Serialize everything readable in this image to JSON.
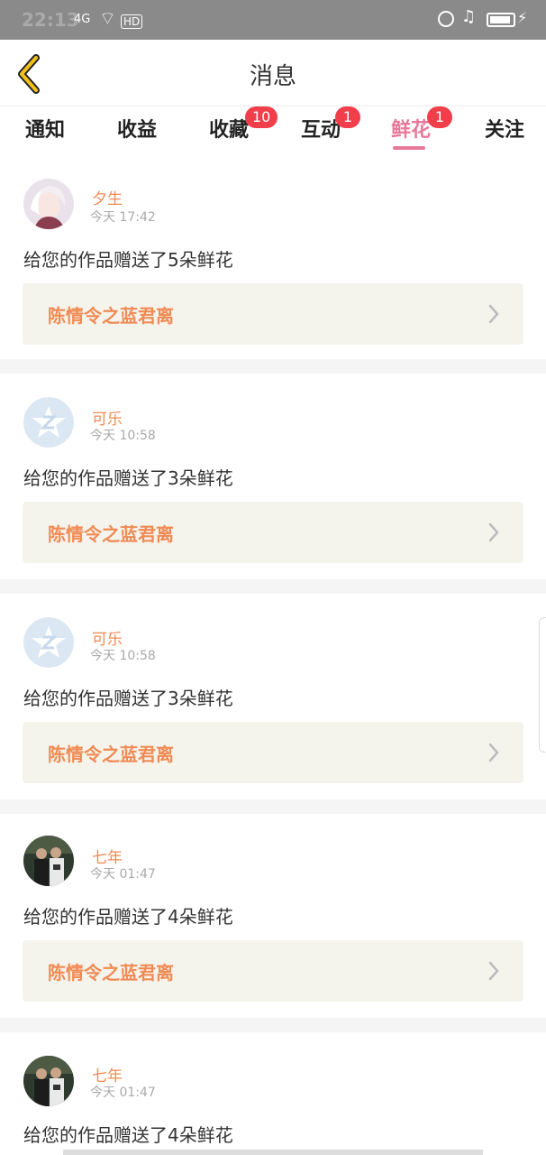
{
  "status_bar": {
    "time": "22:13",
    "network": "4G",
    "hd": "HD"
  },
  "header": {
    "title": "消息"
  },
  "tabs": [
    {
      "label": "通知",
      "badge": ""
    },
    {
      "label": "收益",
      "badge": ""
    },
    {
      "label": "收藏",
      "badge": "10"
    },
    {
      "label": "互动",
      "badge": "1"
    },
    {
      "label": "鲜花",
      "badge": "1",
      "active": true
    },
    {
      "label": "关注",
      "badge": ""
    }
  ],
  "messages": [
    {
      "name": "夕生",
      "time": "今天 17:42",
      "text": "给您的作品赠送了5朵鲜花",
      "work": "陈情令之蓝君离",
      "avatar": "anime-avatar"
    },
    {
      "name": "可乐",
      "time": "今天 10:58",
      "text": "给您的作品赠送了3朵鲜花",
      "work": "陈情令之蓝君离",
      "avatar": "qq-default-avatar"
    },
    {
      "name": "可乐",
      "time": "今天 10:58",
      "text": "给您的作品赠送了3朵鲜花",
      "work": "陈情令之蓝君离",
      "avatar": "qq-default-avatar"
    },
    {
      "name": "七年",
      "time": "今天 01:47",
      "text": "给您的作品赠送了4朵鲜花",
      "work": "陈情令之蓝君离",
      "avatar": "photo-avatar"
    },
    {
      "name": "七年",
      "time": "今天 01:47",
      "text": "给您的作品赠送了4朵鲜花",
      "work": "",
      "avatar": "photo-avatar"
    }
  ],
  "colors": {
    "accent_pink": "#e8789a",
    "name_orange": "#f08b55",
    "badge_red": "#f03e4b",
    "back_arrow": "#f2c01a"
  }
}
